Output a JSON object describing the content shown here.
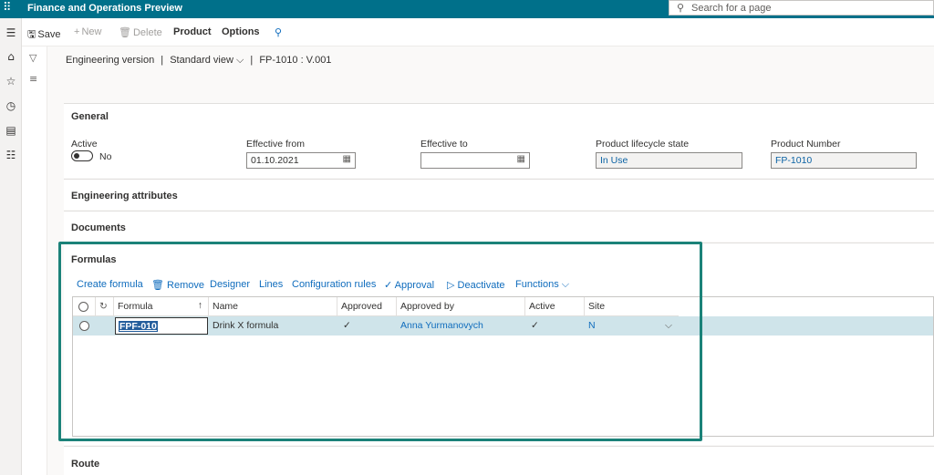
{
  "app": {
    "title": "Finance and Operations Preview",
    "search_placeholder": "Search for a page"
  },
  "actionbar": {
    "save": "Save",
    "new": "New",
    "delete": "Delete",
    "product": "Product",
    "options": "Options"
  },
  "breadcrumb": {
    "version": "Engineering version",
    "sep1": "|",
    "view": "Standard view",
    "sep2": "|",
    "record": "FP-1010 : V.001"
  },
  "general": {
    "title": "General",
    "active_label": "Active",
    "active_value": "No",
    "effective_from_label": "Effective from",
    "effective_from_value": "01.10.2021",
    "effective_to_label": "Effective to",
    "effective_to_value": "",
    "lifecycle_label": "Product lifecycle state",
    "lifecycle_value": "In Use",
    "product_number_label": "Product Number",
    "product_number_value": "FP-1010"
  },
  "sections": {
    "engineering_attributes": "Engineering attributes",
    "documents": "Documents",
    "formulas": "Formulas",
    "route": "Route"
  },
  "formulas_toolbar": {
    "create": "Create formula",
    "remove": "Remove",
    "designer": "Designer",
    "lines": "Lines",
    "config_rules": "Configuration rules",
    "approval": "Approval",
    "deactivate": "Deactivate",
    "functions": "Functions"
  },
  "grid": {
    "headers": {
      "formula": "Formula",
      "name": "Name",
      "approved": "Approved",
      "approved_by": "Approved by",
      "active": "Active",
      "site": "Site"
    },
    "rows": [
      {
        "formula": "FPF-010",
        "name": "Drink X formula",
        "approved": "✓",
        "approved_by": "Anna Yurmanovych",
        "active": "✓",
        "site": "N"
      }
    ]
  },
  "colors": {
    "topbar": "#00708a",
    "highlight": "#1b8279",
    "selected_row": "#cfe4ea",
    "link": "#0f6cbd"
  }
}
